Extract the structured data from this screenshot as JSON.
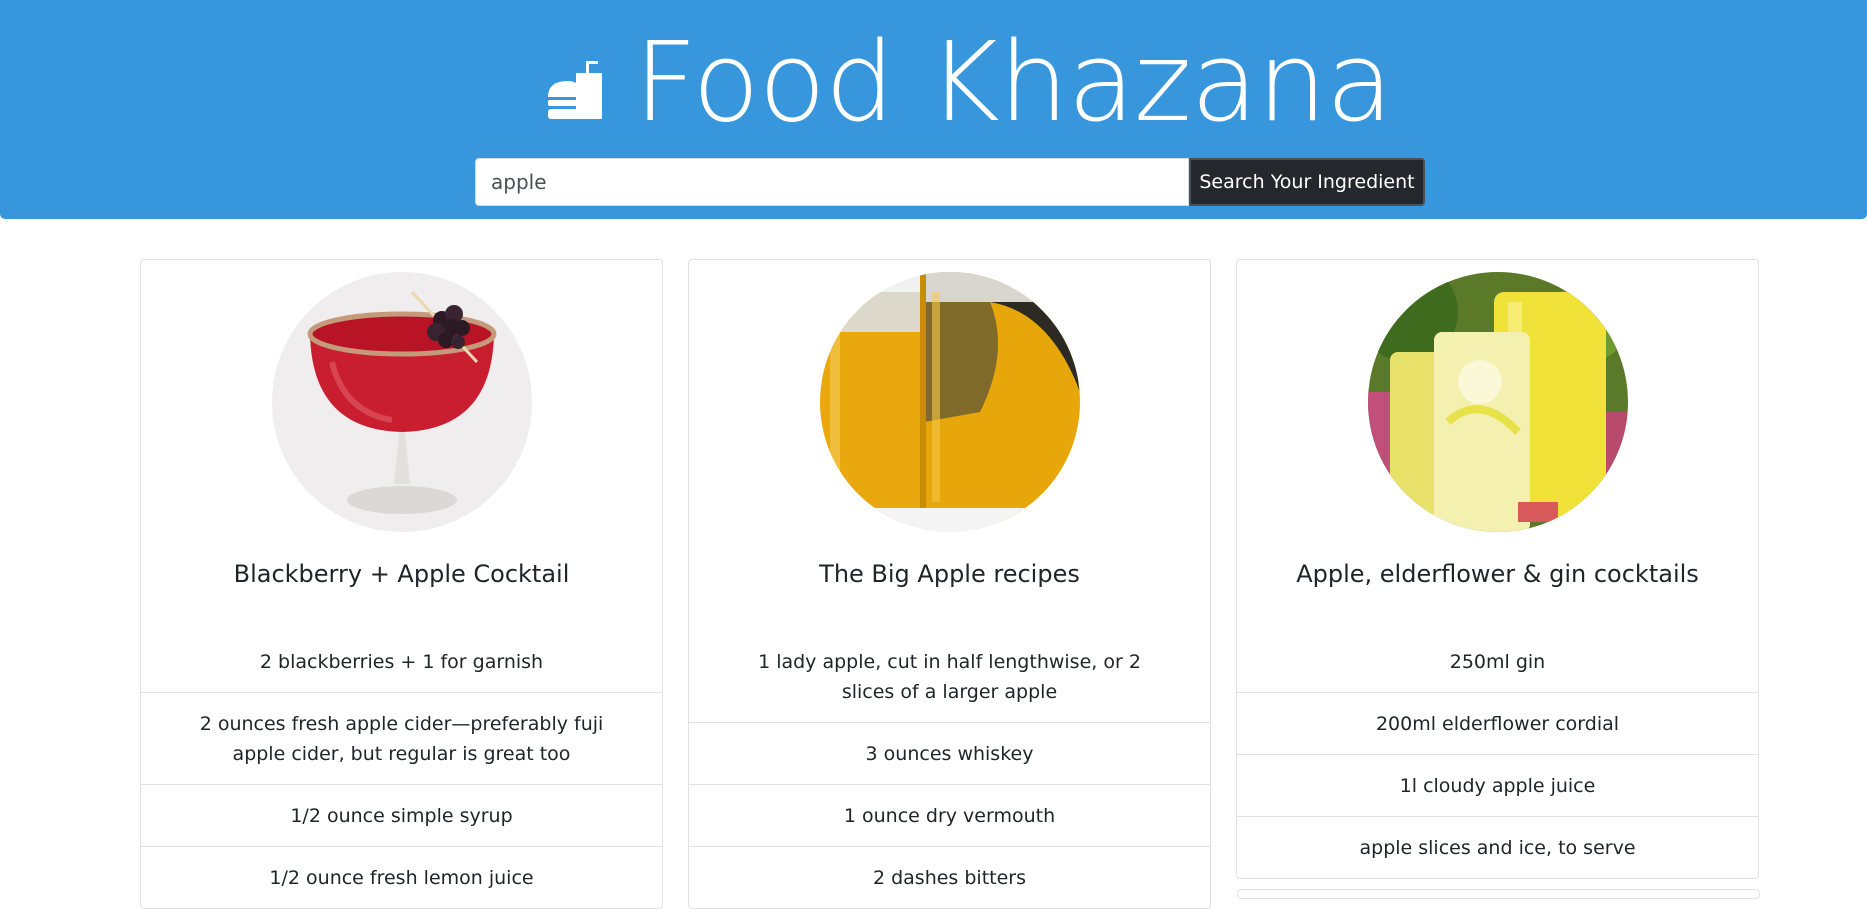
{
  "header": {
    "logo_icon": "burger-drink-icon",
    "title": "Food Khazana",
    "colors": {
      "background": "#3897dc",
      "title": "#ffffff"
    }
  },
  "search": {
    "value": "apple",
    "button_label": "Search Your Ingredient",
    "button_color": "#24272b"
  },
  "recipes": [
    {
      "title": "Blackberry + Apple Cocktail",
      "image_icon": "red-cocktail-with-blackberry",
      "ingredients": [
        "2 blackberries + 1 for garnish",
        "2 ounces fresh apple cider—preferably fuji apple cider, but regular is great too",
        "1/2 ounce simple syrup",
        "1/2 ounce fresh lemon juice"
      ]
    },
    {
      "title": "The Big Apple recipes",
      "image_icon": "whiskey-glasses",
      "ingredients": [
        "1 lady apple, cut in half lengthwise, or 2 slices of a larger apple",
        "3 ounces whiskey",
        "1 ounce dry vermouth",
        "2 dashes bitters"
      ]
    },
    {
      "title": "Apple, elderflower & gin cocktails",
      "image_icon": "yellow-gin-cocktails",
      "ingredients": [
        "250ml gin",
        "200ml elderflower cordial",
        "1l cloudy apple juice",
        "apple slices and ice, to serve"
      ]
    }
  ]
}
